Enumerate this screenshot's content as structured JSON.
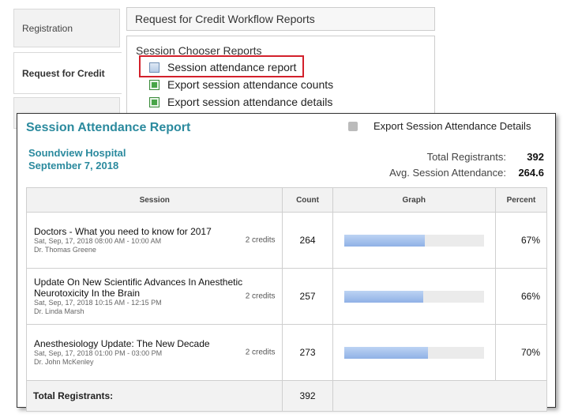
{
  "nav": {
    "tabs": [
      {
        "label": "Registration"
      },
      {
        "label": "Request for Credit"
      },
      {
        "label": ""
      }
    ]
  },
  "workflow": {
    "header": "Request for Credit Workflow Reports",
    "chooser_title": "Session Chooser Reports",
    "items": [
      {
        "label": "Session attendance report",
        "icon": "report-icon"
      },
      {
        "label": "Export session attendance counts",
        "icon": "excel-icon"
      },
      {
        "label": "Export session attendance details",
        "icon": "excel-icon"
      }
    ]
  },
  "report": {
    "title": "Session Attendance Report",
    "export_label": "Export Session Attendance Details",
    "organization": "Soundview Hospital",
    "date": "September 7, 2018",
    "total_registrants_label": "Total Registrants:",
    "total_registrants_value": "392",
    "avg_attendance_label": "Avg. Session Attendance:",
    "avg_attendance_value": "264.6",
    "columns": [
      "Session",
      "Count",
      "Graph",
      "Percent"
    ],
    "sessions": [
      {
        "title": "Doctors - What you need to know for 2017",
        "datetime": "Sat, Sep, 17, 2018 08:00 AM - 10:00 AM",
        "speaker": "Dr. Thomas Greene",
        "credits": "2 credits",
        "count": "264",
        "percent_label": "67%",
        "percent_value": 67
      },
      {
        "title": "Update On New Scientific Advances In Anesthetic Neurotoxicity In the Brain",
        "datetime": "Sat, Sep, 17, 2018 10:15 AM - 12:15 PM",
        "speaker": "Dr. Linda Marsh",
        "credits": "2 credits",
        "count": "257",
        "percent_label": "66%",
        "percent_value": 66
      },
      {
        "title": "Anesthesiology Update: The New Decade",
        "datetime": "Sat, Sep, 17, 2018 01:00 PM - 03:00 PM",
        "speaker": "Dr. John McKenley",
        "credits": "2 credits",
        "count": "273",
        "percent_label": "70%",
        "percent_value": 70
      }
    ],
    "footer_label": "Total Registrants:",
    "footer_count": "392"
  }
}
